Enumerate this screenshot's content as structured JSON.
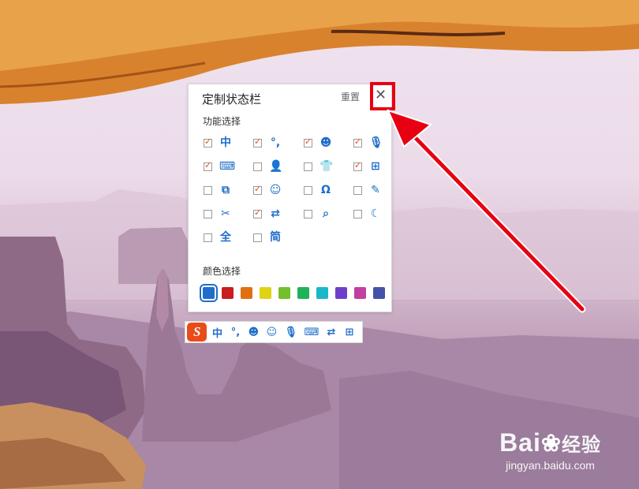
{
  "panel": {
    "title": "定制状态栏",
    "reset_label": "重置",
    "close_label": "✕",
    "function_section_title": "功能选择",
    "color_section_title": "颜色选择",
    "functions": [
      {
        "name": "chinese-mode",
        "icon": "中",
        "checked": true
      },
      {
        "name": "punctuation",
        "icon": "°,",
        "checked": true
      },
      {
        "name": "emoji",
        "icon": "☻",
        "checked": true
      },
      {
        "name": "microphone",
        "icon": "🎙",
        "checked": true
      },
      {
        "name": "keyboard",
        "icon": "⌨",
        "checked": true
      },
      {
        "name": "user",
        "icon": "👤",
        "checked": false
      },
      {
        "name": "skin",
        "icon": "👕",
        "checked": false
      },
      {
        "name": "apps",
        "icon": "⊞",
        "checked": true
      },
      {
        "name": "clipboard",
        "icon": "⧉",
        "checked": false
      },
      {
        "name": "expression",
        "icon": "☺",
        "checked": true
      },
      {
        "name": "special-char",
        "icon": "Ω",
        "checked": false
      },
      {
        "name": "handwriting",
        "icon": "✎",
        "checked": false
      },
      {
        "name": "screenshot",
        "icon": "✂",
        "checked": false
      },
      {
        "name": "translate",
        "icon": "⇄",
        "checked": true
      },
      {
        "name": "search",
        "icon": "⌕",
        "checked": false
      },
      {
        "name": "night-mode",
        "icon": "☾",
        "checked": false
      },
      {
        "name": "full-width",
        "icon": "全",
        "checked": false
      },
      {
        "name": "simplified",
        "icon": "简",
        "checked": false
      }
    ],
    "colors": [
      "#1f6ec9",
      "#c81e1e",
      "#e0700f",
      "#dfd313",
      "#74c02a",
      "#1fb25a",
      "#1ab7c9",
      "#6f3fcc",
      "#c23fa0",
      "#4452a8"
    ],
    "selected_color_index": 0
  },
  "statusbar": {
    "logo_letter": "S",
    "icons": [
      "中",
      "°,",
      "☻",
      "☺",
      "🎙",
      "⌨",
      "⇄",
      "⊞"
    ]
  },
  "watermark": {
    "logo_text": "Bai",
    "logo_suffix": "经验",
    "url": "jingyan.baidu.com"
  }
}
